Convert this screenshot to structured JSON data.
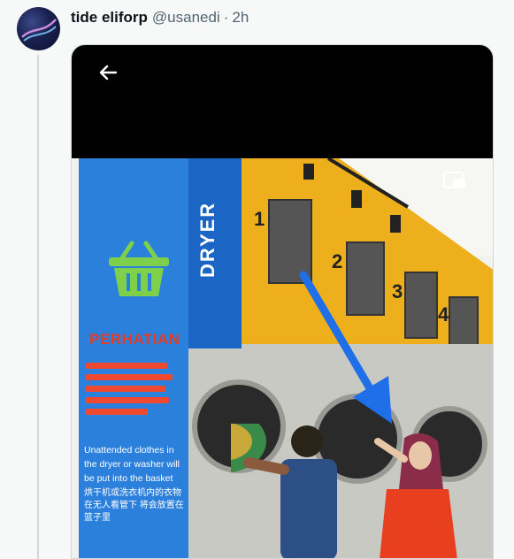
{
  "tweet": {
    "display_name": "tide eliforp",
    "handle": "@usanedi",
    "separator": "·",
    "time": "2h"
  },
  "media": {
    "back_icon": "arrow-left-icon",
    "pip_icon": "picture-in-picture-icon",
    "sign": {
      "dryer_label": "DRYER",
      "warning_title": "PERHATIAN",
      "english_notice": "Unattended clothes in the dryer or washer will be put into the basket",
      "chinese_notice": "烘干机或洗衣机内的衣物 在无人看管下 将会放置在篮子里"
    },
    "steps": [
      "1",
      "2",
      "3",
      "4"
    ],
    "colors": {
      "panel_blue": "#2b80dc",
      "wall_yellow": "#eeaf1c",
      "arrow_blue": "#1e6fe8",
      "warning_red": "#e43c23"
    }
  }
}
